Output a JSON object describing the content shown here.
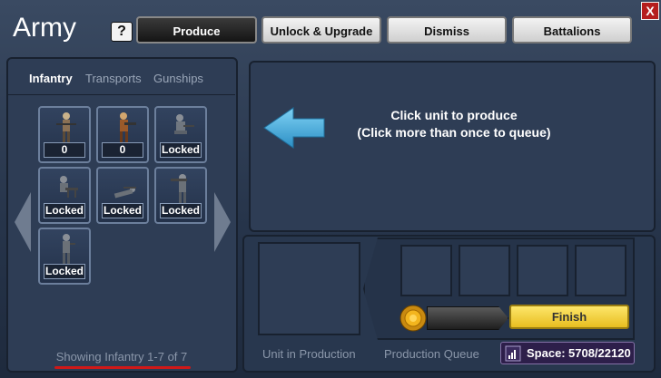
{
  "window": {
    "title": "Army",
    "help_label": "?",
    "close_label": "X"
  },
  "tabs": [
    {
      "label": "Produce",
      "active": true
    },
    {
      "label": "Unlock & Upgrade",
      "active": false
    },
    {
      "label": "Dismiss",
      "active": false
    },
    {
      "label": "Battalions",
      "active": false
    }
  ],
  "unit_tabs": [
    {
      "label": "Infantry",
      "active": true
    },
    {
      "label": "Transports",
      "active": false
    },
    {
      "label": "Gunships",
      "active": false
    }
  ],
  "units": [
    {
      "label": "0",
      "icon": "soldier-rifle-icon"
    },
    {
      "label": "0",
      "icon": "soldier-gunner-icon"
    },
    {
      "label": "Locked",
      "icon": "soldier-crouch-icon"
    },
    {
      "label": "Locked",
      "icon": "soldier-machinegun-icon"
    },
    {
      "label": "Locked",
      "icon": "soldier-prone-icon"
    },
    {
      "label": "Locked",
      "icon": "soldier-rocket-icon"
    },
    {
      "label": "Locked",
      "icon": "soldier-officer-icon"
    }
  ],
  "showing_text": "Showing Infantry 1-7 of 7",
  "hint": {
    "line1": "Click unit to produce",
    "line2": "(Click more than once to queue)"
  },
  "production": {
    "unit_label": "Unit in Production",
    "queue_label": "Production Queue",
    "finish_label": "Finish",
    "progress": 0
  },
  "space": {
    "label": "Space:",
    "value": "5708/22120"
  },
  "colors": {
    "accent_finish": "#f1d13a",
    "hint_arrow": "#4aa9d8",
    "underline": "#d01818"
  }
}
